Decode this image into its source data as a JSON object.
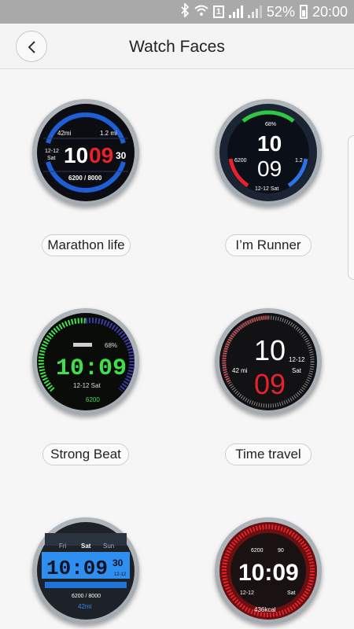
{
  "status_bar": {
    "battery_percent": "52%",
    "time": "20:00",
    "sim_label": "1",
    "icons": [
      "bluetooth-icon",
      "wifi-icon",
      "sim-icon",
      "signal-icon",
      "signal-icon",
      "battery-charging-icon"
    ]
  },
  "header": {
    "title": "Watch Faces",
    "back_icon": "chevron-left-icon"
  },
  "faces": [
    {
      "label": "Marathon life",
      "display": {
        "steps_dist": "42mi",
        "run_dist": "1.2 mi",
        "date": "12-12",
        "day": "Sat",
        "hour": "10",
        "minute": "09",
        "seconds": "30",
        "steps": "6200 / 8000"
      }
    },
    {
      "label": "I’m Runner",
      "display": {
        "battery": "68%",
        "hour": "10",
        "minute": "09",
        "steps": "6200",
        "distance": "1.2",
        "date": "12-12 Sat"
      }
    },
    {
      "label": "Strong Beat",
      "display": {
        "battery": "68%",
        "time": "10:09",
        "date": "12-12 Sat",
        "steps": "6200"
      }
    },
    {
      "label": "Time travel",
      "display": {
        "hour": "10",
        "minute": "09",
        "distance": "42 mi",
        "date": "12-12",
        "day": "Sat"
      }
    },
    {
      "label": "",
      "display": {
        "day_prev": "Fri",
        "day": "Sat",
        "day_next": "Sun",
        "time": "10:09",
        "seconds": "30",
        "date": "12-12",
        "steps": "6200 / 8000",
        "distance": "42mi"
      }
    },
    {
      "label": "",
      "display": {
        "steps": "6200",
        "heart": "90",
        "time": "10:09",
        "date": "12-12",
        "day": "Sat",
        "calories": "436kcal"
      }
    }
  ]
}
